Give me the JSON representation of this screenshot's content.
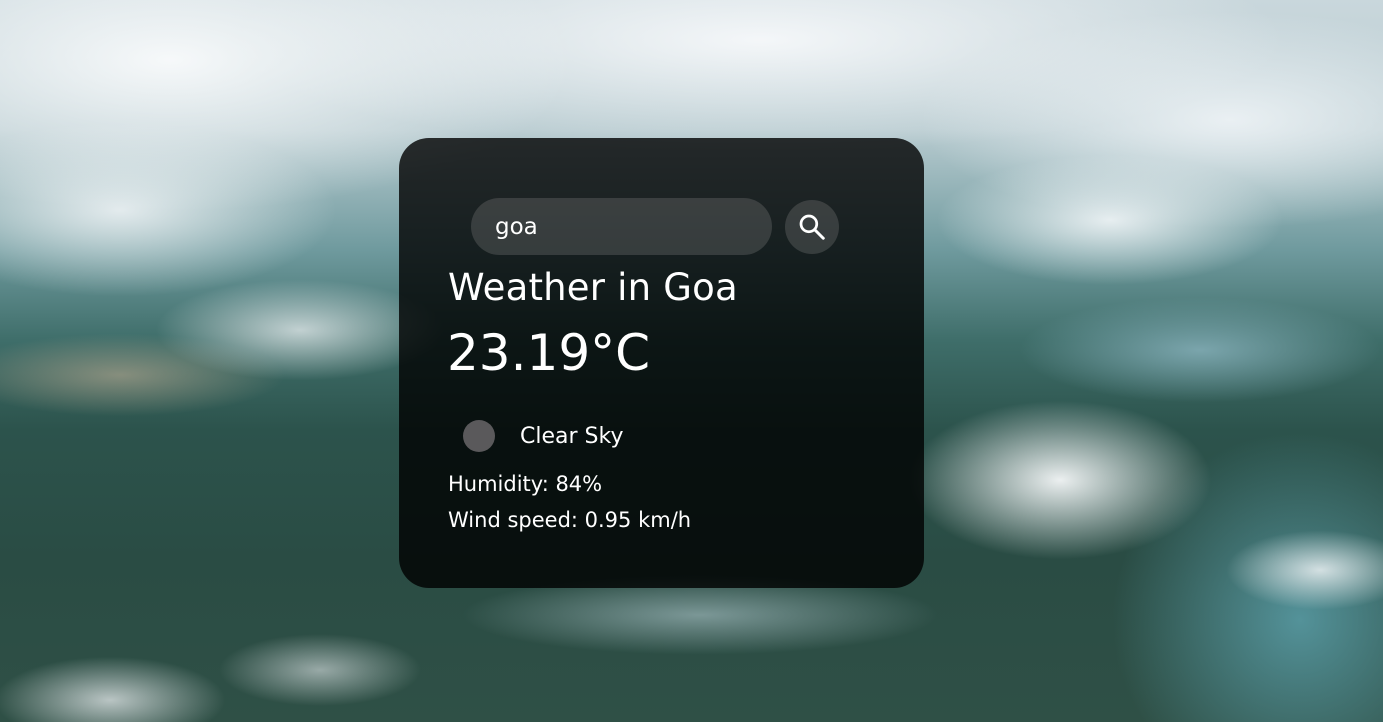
{
  "search": {
    "value": "goa",
    "button_icon": "search-icon"
  },
  "weather": {
    "title": "Weather in Goa",
    "temperature": "23.19°C",
    "condition": "Clear Sky",
    "condition_icon": "weather-condition-icon",
    "humidity": "Humidity: 84%",
    "wind": "Wind speed: 0.95 km/h"
  },
  "colors": {
    "card_background": "#000000cc",
    "text": "#ffffff",
    "control_background": "#7c7c7c52"
  }
}
